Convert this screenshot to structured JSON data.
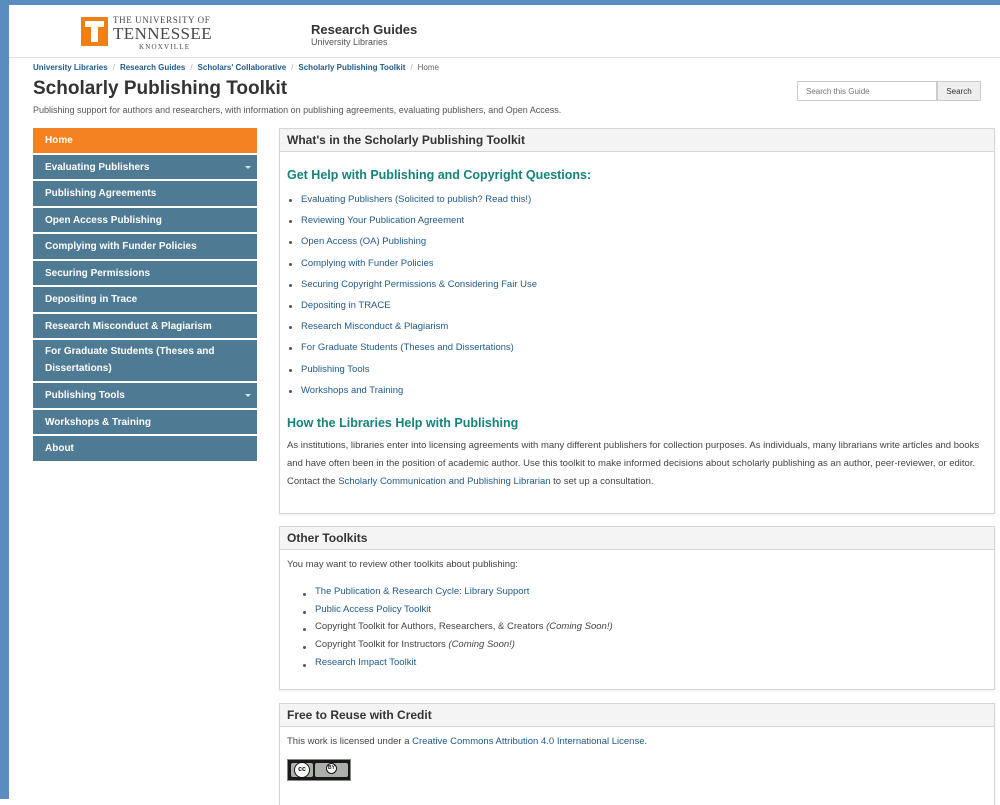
{
  "header": {
    "logo_small": "THE UNIVERSITY OF",
    "logo_big": "TENNESSEE",
    "logo_place": "KNOXVILLE",
    "site_title": "Research Guides",
    "site_subtitle": "University Libraries"
  },
  "breadcrumb": [
    "University Libraries",
    "Research Guides",
    "Scholars' Collaborative",
    "Scholarly Publishing Toolkit",
    "Home"
  ],
  "page": {
    "title": "Scholarly Publishing Toolkit",
    "subtitle": "Publishing support for authors and researchers, with information on publishing agreements, evaluating publishers, and Open Access."
  },
  "search": {
    "placeholder": "Search this Guide",
    "button": "Search"
  },
  "sidebar": {
    "items": [
      {
        "label": "Home"
      },
      {
        "label": "Evaluating Publishers"
      },
      {
        "label": "Publishing Agreements"
      },
      {
        "label": "Open Access Publishing"
      },
      {
        "label": "Complying with Funder Policies"
      },
      {
        "label": "Securing Permissions"
      },
      {
        "label": "Depositing in Trace"
      },
      {
        "label": "Research Misconduct & Plagiarism"
      },
      {
        "label": "For Graduate Students (Theses and Dissertations)"
      },
      {
        "label": "Publishing Tools"
      },
      {
        "label": "Workshops & Training"
      },
      {
        "label": "About"
      }
    ]
  },
  "toolkit_box": {
    "title": "What's in the Scholarly Publishing Toolkit",
    "help_heading": "Get Help with Publishing and Copyright Questions:",
    "links": [
      "Evaluating Publishers (Solicited to publish? Read this!)",
      "Reviewing Your Publication Agreement",
      "Open Access (OA) Publishing",
      "Complying with Funder Policies",
      "Securing Copyright Permissions & Considering Fair Use",
      "Depositing in TRACE",
      "Research Misconduct & Plagiarism",
      "For Graduate Students (Theses and Dissertations)",
      "Publishing Tools",
      "Workshops and Training"
    ],
    "libraries_heading": "How the Libraries Help with Publishing",
    "para_part1": "As institutions, libraries enter into licensing agreements with many different publishers for collection purposes. As individuals, many librarians write articles and books and have often been in the position of academic author. Use this toolkit to make informed decisions about scholarly publishing as an author, peer-reviewer, or editor. Contact the ",
    "para_link": "Scholarly Communication and Publishing Librarian",
    "para_part2": " to set up a consultation."
  },
  "other_box": {
    "title": "Other Toolkits",
    "intro": "You may want to review other toolkits about publishing:",
    "item1": "The Publication & Research Cycle: Library Support",
    "item2": "Public Access Policy Toolkit",
    "item3_text": "Copyright Toolkit for Authors, Researchers, & Creators ",
    "item3_note": "(Coming Soon!)",
    "item4_text": "Copyright Toolkit for Instructors ",
    "item4_note": "(Coming Soon!)",
    "item5": "Research Impact Toolkit"
  },
  "reuse_box": {
    "title": "Free to Reuse with Credit",
    "text": "This work is licensed under a ",
    "link": "Creative Commons Attribution 4.0 International License",
    "text_end": ".",
    "badge_cc": "cc",
    "badge_by": "BY"
  },
  "colors": {
    "accent_orange": "#f58220",
    "nav_blue": "#4f7a94",
    "heading_green": "#16837a",
    "link_blue": "#1f5a8a"
  }
}
